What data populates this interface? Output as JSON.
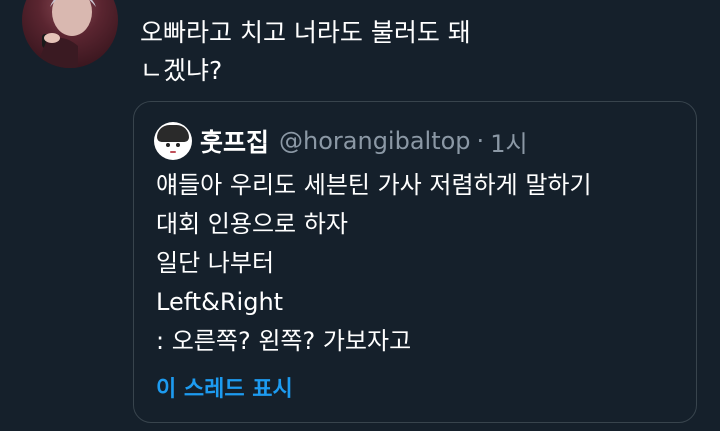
{
  "tweet": {
    "text_lines": [
      "오빠라고 치고 너라도 불러도 돼",
      "ㄴ겠냐?"
    ]
  },
  "quote": {
    "name": "훗프집",
    "handle": "@horangibaltop",
    "separator": "·",
    "time": "1시",
    "body_lines": [
      "얘들아 우리도 세븐틴 가사 저렴하게 말하기",
      "대회 인용으로 하자",
      "일단 나부터",
      "Left&Right",
      ": 오른쪽? 왼쪽? 가보자고"
    ],
    "show_thread": "이 스레드 표시"
  },
  "colors": {
    "background": "#15202b",
    "border": "#38444d",
    "secondary_text": "#8b98a5",
    "link": "#1d9bf0"
  }
}
